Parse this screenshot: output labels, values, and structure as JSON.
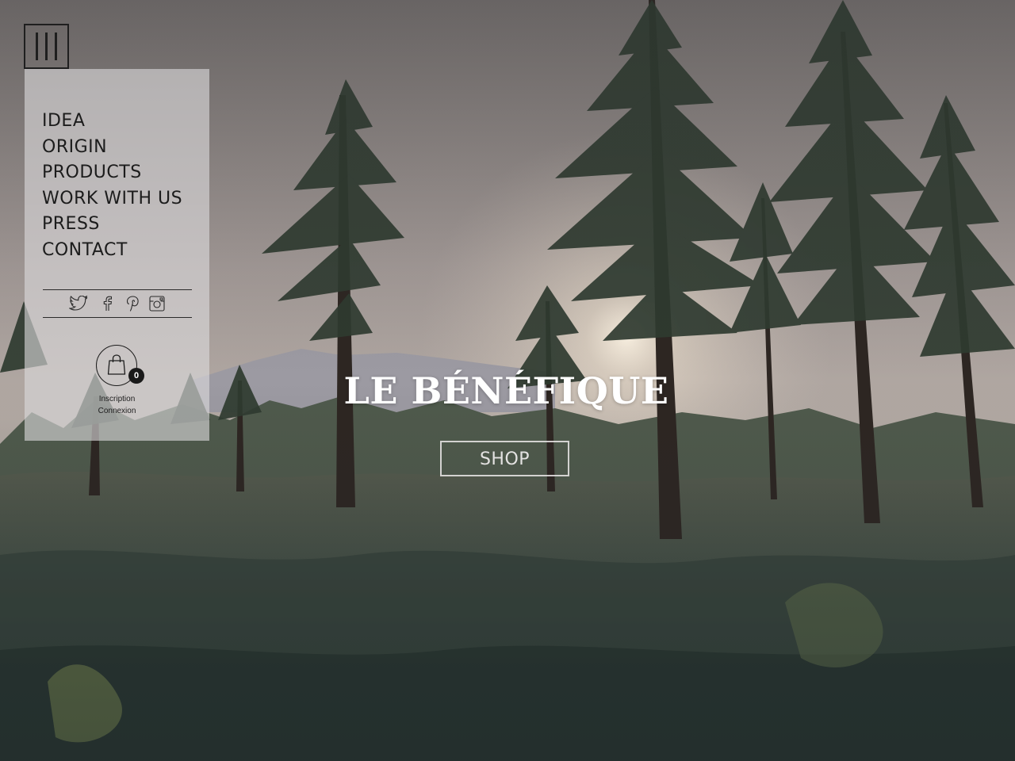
{
  "nav": {
    "items": [
      {
        "label": "IDEA"
      },
      {
        "label": "ORIGIN"
      },
      {
        "label": "PRODUCTS"
      },
      {
        "label": "WORK WITH US"
      },
      {
        "label": "PRESS"
      },
      {
        "label": "CONTACT"
      }
    ]
  },
  "social": [
    "twitter-icon",
    "facebook-icon",
    "pinterest-icon",
    "instagram-icon"
  ],
  "cart": {
    "count": "0"
  },
  "account": {
    "signup_label": "Inscription",
    "login_label": "Connexion"
  },
  "hero": {
    "title": "LE BÉNÉFIQUE",
    "shop_label": "SHOP"
  },
  "colors": {
    "panel": "#dcdadc",
    "text_dark": "#1c1c1c",
    "title": "#ffffff"
  }
}
